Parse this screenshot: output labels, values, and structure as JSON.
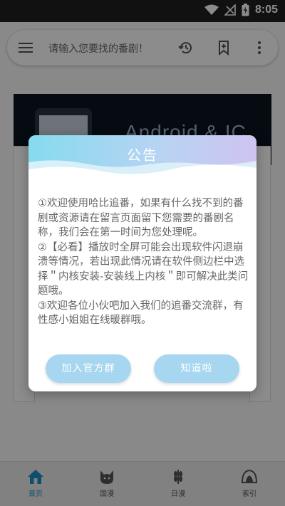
{
  "status_bar": {
    "time": "8:05"
  },
  "search": {
    "placeholder": "请输入您要找的番剧！"
  },
  "banner": {
    "text": "Android & IC"
  },
  "dialog": {
    "title": "公告",
    "paragraphs": [
      "①欢迎使用哈比追番，如果有什么找不到的番剧或资源请在留言页面留下您需要的番剧名称，我们会在第一时间为您处理呢。",
      "②【必看】播放时全屏可能会出现软件闪退崩溃等情况，若出现此情况请在软件侧边栏中选择＂内核安装-安装线上内核＂即可解决此类问题哦。",
      "③欢迎各位小伙吧加入我们的追番交流群，有性感小姐姐在线暖群哦。"
    ],
    "join_button": "加入官方群",
    "ok_button": "知道啦"
  },
  "bottom_nav": [
    {
      "label": "首页",
      "icon": "home-icon",
      "active": true
    },
    {
      "label": "国漫",
      "icon": "cat-icon",
      "active": false
    },
    {
      "label": "日漫",
      "icon": "wheat-icon",
      "active": false
    },
    {
      "label": "索引",
      "icon": "leaf-icon",
      "active": false
    }
  ],
  "colors": {
    "accent": "#1e8fc7",
    "button": "#a6d6f0",
    "header_start": "#85dbee",
    "header_end": "#cfc3f2"
  }
}
